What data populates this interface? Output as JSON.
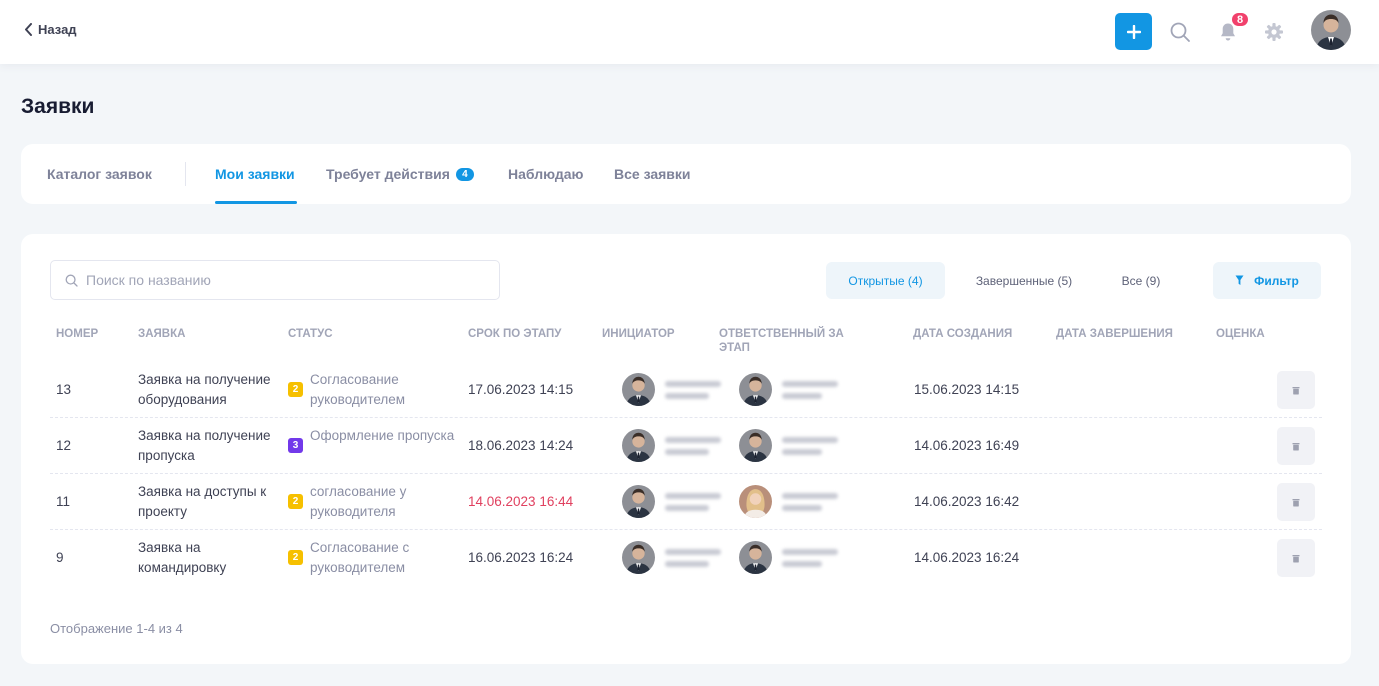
{
  "header": {
    "back_label": "Назад",
    "notifications_count": "8",
    "icons": [
      "chevron-left-icon",
      "plus-icon",
      "search-icon",
      "bell-icon",
      "gear-icon",
      "user-avatar"
    ]
  },
  "page": {
    "title": "Заявки"
  },
  "tabs": [
    {
      "label": "Каталог заявок",
      "active": false
    },
    {
      "label": "Мои заявки",
      "active": true
    },
    {
      "label": "Требует действия",
      "badge": "4",
      "active": false
    },
    {
      "label": "Наблюдаю",
      "active": false
    },
    {
      "label": "Все заявки",
      "active": false
    }
  ],
  "toolbar": {
    "search_placeholder": "Поиск по названию",
    "segments": [
      {
        "label": "Открытые (4)",
        "active": true
      },
      {
        "label": "Завершенные (5)",
        "active": false
      },
      {
        "label": "Все (9)",
        "active": false
      }
    ],
    "filter_label": "Фильтр"
  },
  "table": {
    "columns": [
      "Номер",
      "Заявка",
      "Статус",
      "Срок по этапу",
      "Инициатор",
      "Ответственный за этап",
      "Дата создания",
      "Дата завершения",
      "Оценка"
    ],
    "rows": [
      {
        "number": "13",
        "name": "Заявка на получение оборудования",
        "stage_num": "2",
        "status": "Согласование руководителем",
        "due": "17.06.2023 14:15",
        "overdue": false,
        "created": "15.06.2023 14:15",
        "completed": "",
        "rating": ""
      },
      {
        "number": "12",
        "name": "Заявка на получение пропуска",
        "stage_num": "3",
        "status": "Оформление пропуска",
        "due": "18.06.2023 14:24",
        "overdue": false,
        "created": "14.06.2023 16:49",
        "completed": "",
        "rating": ""
      },
      {
        "number": "11",
        "name": "Заявка на доступы к проекту",
        "stage_num": "2",
        "status": "согласование у руководителя",
        "due": "14.06.2023 16:44",
        "overdue": true,
        "created": "14.06.2023 16:42",
        "completed": "",
        "rating": ""
      },
      {
        "number": "9",
        "name": "Заявка на командировку",
        "stage_num": "2",
        "status": "Согласование с руководителем",
        "due": "16.06.2023 16:24",
        "overdue": false,
        "created": "14.06.2023 16:24",
        "completed": "",
        "rating": ""
      }
    ]
  },
  "footer": {
    "info": "Отображение 1-4 из 4"
  },
  "colors": {
    "accent": "#1296e3",
    "stage_2": "#f6c000",
    "stage_3": "#7239ea",
    "overdue": "#e0405f",
    "badge": "#f1416c"
  }
}
